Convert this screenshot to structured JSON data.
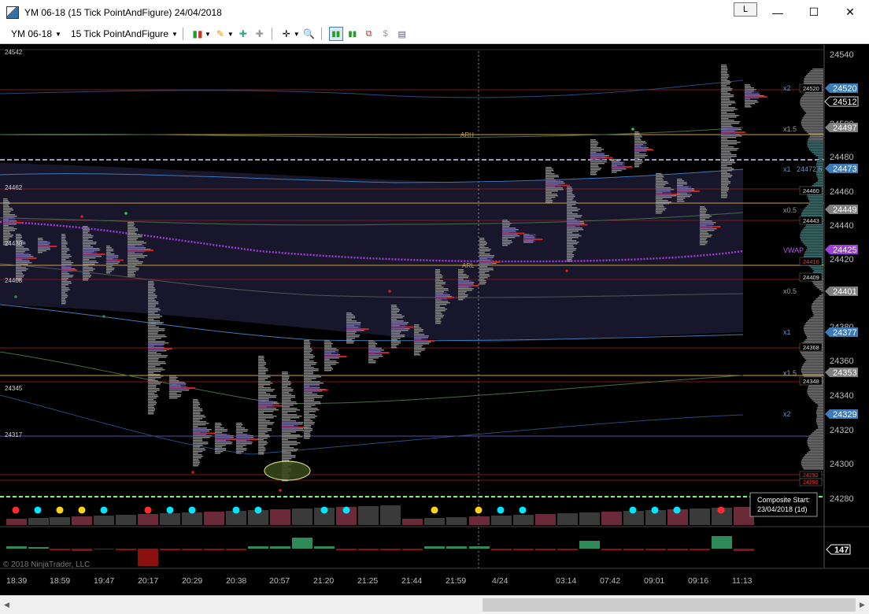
{
  "window": {
    "title": "YM 06-18 (15 Tick PointAndFigure)  24/04/2018",
    "link_label": "L",
    "minimize": "—",
    "maximize": "☐",
    "close": "✕"
  },
  "toolbar": {
    "instrument": "YM 06-18",
    "period": "15 Tick PointAndFigure",
    "icons": [
      "bar-style-icon",
      "drawing-tool-icon",
      "add-indicator-icon",
      "remove-indicator-icon",
      "crosshair-icon",
      "zoom-icon",
      "chart-style-icon",
      "data-series-icon",
      "strategies-icon",
      "properties-icon",
      "templates-icon"
    ]
  },
  "chart": {
    "copyright": "© 2018 NinjaTrader, LLC",
    "composite_start_title": "Composite Start:",
    "composite_start_value": "23/04/2018 (1d)",
    "price_axis": [
      "24540",
      "24500",
      "24480",
      "24460",
      "24440",
      "24420",
      "24380",
      "24360",
      "24340",
      "24320",
      "24300",
      "24280"
    ],
    "left_price_tags": [
      "24542",
      "24462",
      "24430",
      "24408",
      "24345",
      "24317"
    ],
    "level_labels": {
      "arh": "ARH",
      "arl": "ARL",
      "x2_upper": "x2",
      "x15_upper": "x1.5",
      "x1_upper": "x1",
      "x05_upper": "x0.5",
      "vwap": "VWAP",
      "x05_lower": "x0.5",
      "x1_lower": "x1",
      "x15_lower": "x1.5",
      "x2_lower": "x2",
      "x1_upper_value": "24472.5"
    },
    "small_tags": [
      "24520",
      "24460",
      "24443",
      "24416",
      "24409",
      "24368",
      "24348",
      "24292",
      "24290"
    ],
    "right_tags": [
      {
        "label": "24520",
        "color": "#3d7ab8"
      },
      {
        "label": "24512",
        "color": "#000000"
      },
      {
        "label": "24497",
        "color": "#808080"
      },
      {
        "label": "24473",
        "color": "#3d7ab8"
      },
      {
        "label": "24449",
        "color": "#808080"
      },
      {
        "label": "24425",
        "color": "#9b3fd6"
      },
      {
        "label": "24401",
        "color": "#808080"
      },
      {
        "label": "24377",
        "color": "#3d7ab8"
      },
      {
        "label": "24353",
        "color": "#808080"
      },
      {
        "label": "24329",
        "color": "#3d7ab8"
      }
    ],
    "lower_value": "147",
    "time_axis": [
      "18:39",
      "18:59",
      "19:47",
      "20:17",
      "20:29",
      "20:38",
      "20:57",
      "21:20",
      "21:25",
      "21:44",
      "21:59",
      "4/24",
      "03:14",
      "07:42",
      "09:01",
      "09:16",
      "11:13"
    ],
    "colors": {
      "vwap": "#9b3fd6",
      "band": "#3d7ab8",
      "arh": "#c8a040",
      "profile": "#8a8a8a",
      "poc": "#d02020",
      "value_area": "#5a4aaa",
      "positive_delta": "#2e8b57",
      "negative_delta": "#8b1010",
      "dashed_green": "#7cf27c"
    }
  }
}
